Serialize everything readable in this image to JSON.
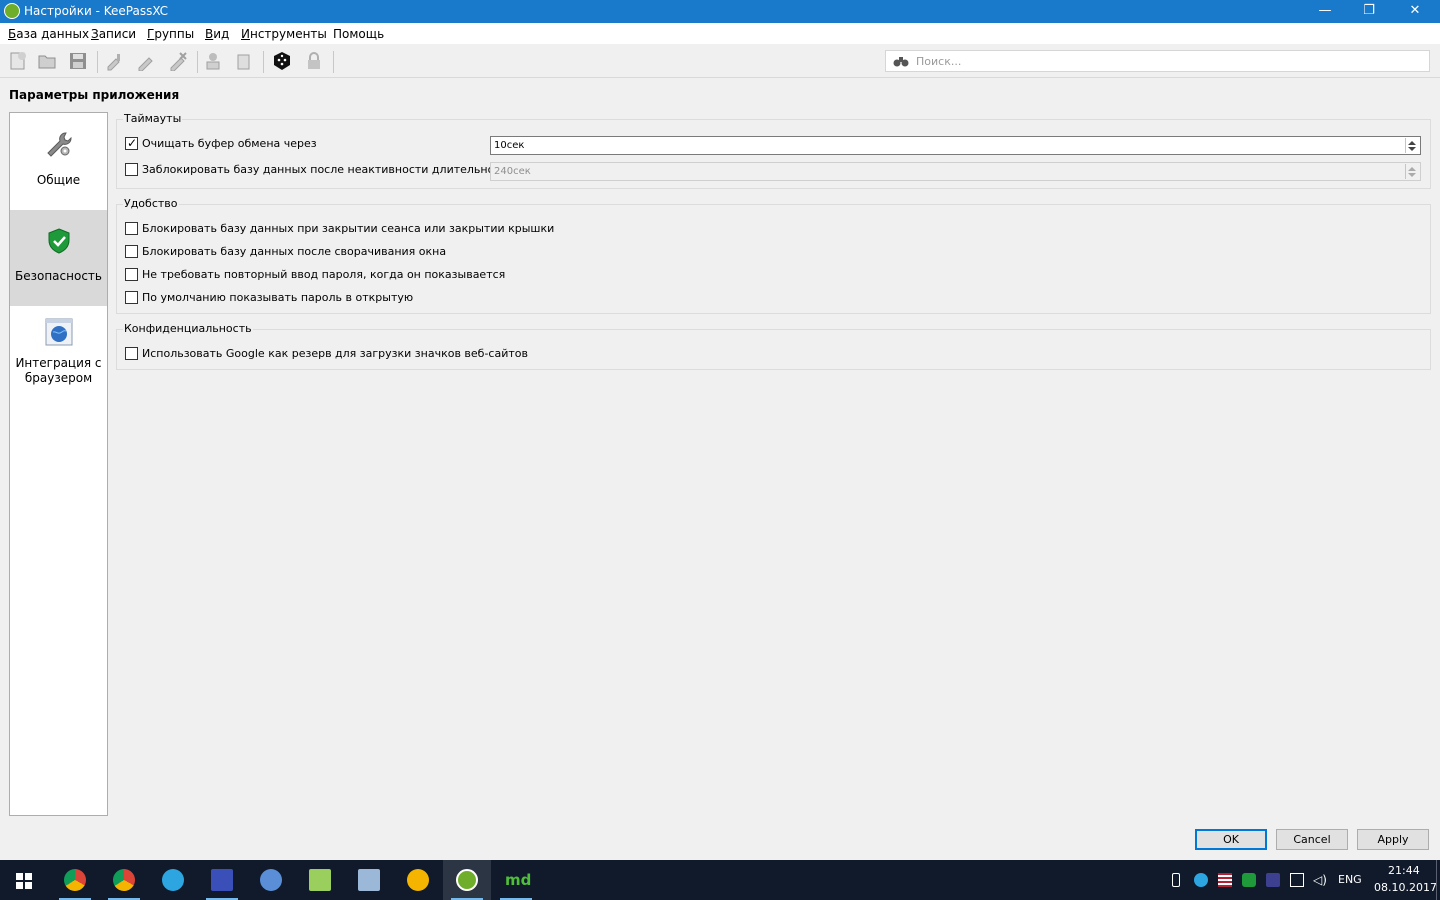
{
  "window": {
    "title": "Настройки - KeePassXC",
    "minimize": "—",
    "restore": "❐",
    "close": "✕"
  },
  "menu": [
    {
      "first": "Б",
      "rest": "аза данных"
    },
    {
      "first": "З",
      "rest": "аписи"
    },
    {
      "first": "Г",
      "rest": "руппы"
    },
    {
      "first": "В",
      "rest": "ид"
    },
    {
      "first": "И",
      "rest": "нструменты"
    },
    {
      "first": "",
      "rest": "Помощь"
    }
  ],
  "toolbar": {
    "search_placeholder": "Поиск..."
  },
  "page_title": "Параметры приложения",
  "categories": [
    {
      "label": "Общие",
      "icon": "wrench-gear-icon"
    },
    {
      "label": "Безопасность",
      "icon": "shield-check-icon",
      "selected": true
    },
    {
      "label_line1": "Интеграция с",
      "label_line2": "браузером",
      "icon": "browser-globe-icon"
    }
  ],
  "timeouts": {
    "title": "Таймауты",
    "clear_clipboard": {
      "label": "Очищать буфер обмена через",
      "checked": true,
      "value": "10сек"
    },
    "lock_inactive": {
      "label": "Заблокировать базу данных после неактивности длительностью",
      "checked": false,
      "value": "240сек"
    }
  },
  "convenience": {
    "title": "Удобство",
    "items": [
      {
        "label": "Блокировать базу данных при закрытии сеанса или закрытии крышки",
        "checked": false
      },
      {
        "label": "Блокировать базу данных после сворачивания окна",
        "checked": false
      },
      {
        "label": "Не требовать повторный ввод пароля, когда он показывается",
        "checked": false
      },
      {
        "label": "По умолчанию показывать пароль в открытую",
        "checked": false
      }
    ]
  },
  "privacy": {
    "title": "Конфиденциальность",
    "items": [
      {
        "label": "Использовать Google как резерв для загрузки значков веб-сайтов",
        "checked": false
      }
    ]
  },
  "buttons": {
    "ok": "OK",
    "cancel": "Cancel",
    "apply": "Apply"
  },
  "taskbar": {
    "lang": "ENG",
    "time": "21:44",
    "date": "08.10.2017"
  },
  "colors": {
    "titlebar": "#1979ca",
    "taskbar": "#101a2b",
    "accent": "#0078d7"
  },
  "checkmark": "✓"
}
